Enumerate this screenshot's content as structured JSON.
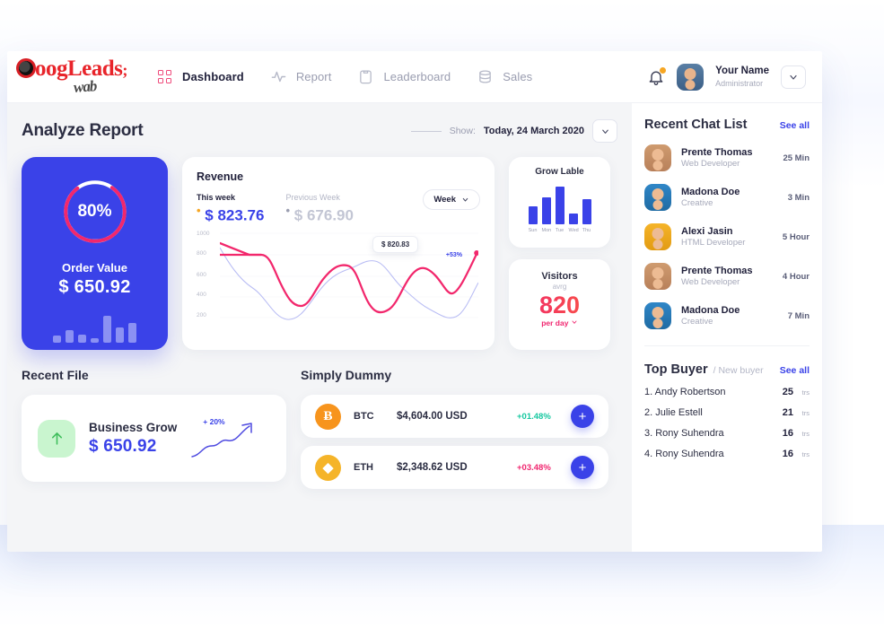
{
  "brand": {
    "name_part1": "G",
    "name_part2": "oog",
    "name_part3": "L",
    "name_part4": "eads",
    "script": "wab"
  },
  "nav": {
    "items": [
      {
        "label": "Dashboard",
        "icon": "grid-icon",
        "active": true
      },
      {
        "label": "Report",
        "icon": "activity-icon",
        "active": false
      },
      {
        "label": "Leaderboard",
        "icon": "clipboard-icon",
        "active": false
      },
      {
        "label": "Sales",
        "icon": "database-icon",
        "active": false
      }
    ]
  },
  "user": {
    "name": "Your Name",
    "role": "Administrator"
  },
  "header": {
    "page_title": "Analyze Report",
    "show_label": "Show:",
    "show_value": "Today, 24 March 2020"
  },
  "order_card": {
    "percent_label": "80%",
    "percent_value": 80,
    "title": "Order Value",
    "value": "$ 650.92",
    "bars": [
      8,
      14,
      9,
      5,
      30,
      17,
      22
    ]
  },
  "revenue": {
    "title": "Revenue",
    "this_week_label": "This week",
    "this_week_value": "$ 823.76",
    "prev_week_label": "Previous Week",
    "prev_week_value": "$ 676.90",
    "range_button": "Week",
    "tooltip": "$ 820.83",
    "growth_badge": "+53%"
  },
  "grow": {
    "title": "Grow Lable",
    "days": [
      "Sun",
      "Mon",
      "Tue",
      "Wed",
      "Thu"
    ],
    "values": [
      20,
      30,
      42,
      12,
      28
    ]
  },
  "visitors": {
    "title": "Visitors",
    "subtitle": "avrg",
    "value": "820",
    "unit": "per day"
  },
  "recent_file": {
    "section_title": "Recent File",
    "name": "Business Grow",
    "value": "$ 650.92",
    "growth": "+ 20%"
  },
  "simply_dummy": {
    "section_title": "Simply Dummy",
    "rows": [
      {
        "symbol": "BTC",
        "glyph": "Ƀ",
        "price": "$4,604.00 USD",
        "change": "+01.48%",
        "change_color": "#16c8a0",
        "add": "+"
      },
      {
        "symbol": "ETH",
        "glyph": "◆",
        "price": "$2,348.62 USD",
        "change": "+03.48%",
        "change_color": "#f0266f",
        "add": "+"
      }
    ]
  },
  "chat": {
    "title": "Recent Chat List",
    "see_all": "See all",
    "items": [
      {
        "name": "Prente Thomas",
        "role": "Web Developer",
        "time": "25 Min",
        "avatar": "a1"
      },
      {
        "name": "Madona Doe",
        "role": "Creative",
        "time": "3 Min",
        "avatar": "a2"
      },
      {
        "name": "Alexi Jasin",
        "role": "HTML  Developer",
        "time": "5 Hour",
        "avatar": "a3"
      },
      {
        "name": "Prente Thomas",
        "role": "Web Developer",
        "time": "4 Hour",
        "avatar": "a1"
      },
      {
        "name": "Madona Doe",
        "role": "Creative",
        "time": "7 Min",
        "avatar": "a2"
      }
    ]
  },
  "top_buyer": {
    "title": "Top Buyer",
    "subtitle": "/ New buyer",
    "see_all": "See all",
    "rows": [
      {
        "name": "1. Andy Robertson",
        "count": "25",
        "unit": "trs"
      },
      {
        "name": "2. Julie Estell",
        "count": "21",
        "unit": "trs"
      },
      {
        "name": "3. Rony Suhendra",
        "count": "16",
        "unit": "trs"
      },
      {
        "name": "4. Rony Suhendra",
        "count": "16",
        "unit": "trs"
      }
    ]
  },
  "chart_data": {
    "type": "line",
    "title": "Revenue",
    "ylabel": "",
    "xlabel": "",
    "ylim": [
      200,
      1000
    ],
    "yticks": [
      1000,
      800,
      600,
      400,
      200
    ],
    "grid": true,
    "legend": [
      "This week",
      "Previous Week"
    ],
    "series": [
      {
        "name": "This week",
        "color": "#f2276c",
        "values": [
          860,
          800,
          800,
          800,
          800,
          560,
          300,
          290,
          380,
          600,
          690,
          660,
          480,
          260,
          220,
          300,
          520,
          680,
          660,
          540,
          460,
          450,
          500,
          620,
          770
        ]
      },
      {
        "name": "Previous Week",
        "color": "#b9bdf4",
        "values": [
          850,
          700,
          590,
          500,
          450,
          430,
          330,
          290,
          310,
          380,
          430,
          450,
          540,
          670,
          690,
          620,
          500,
          400,
          330,
          300,
          270,
          200,
          170,
          300,
          490
        ]
      }
    ],
    "annotations": [
      {
        "text": "$ 820.83",
        "type": "tooltip"
      },
      {
        "text": "+53%",
        "type": "endpoint-badge"
      }
    ]
  },
  "chart_data_grow": {
    "type": "bar",
    "title": "Grow Lable",
    "categories": [
      "Sun",
      "Mon",
      "Tue",
      "Wed",
      "Thu"
    ],
    "values": [
      20,
      30,
      42,
      12,
      28
    ],
    "ylabel": "",
    "xlabel": ""
  },
  "chart_data_order": {
    "type": "bar",
    "title": "Order Value",
    "categories": [
      "1",
      "2",
      "3",
      "4",
      "5",
      "6",
      "7"
    ],
    "values": [
      8,
      14,
      9,
      5,
      30,
      17,
      22
    ]
  }
}
